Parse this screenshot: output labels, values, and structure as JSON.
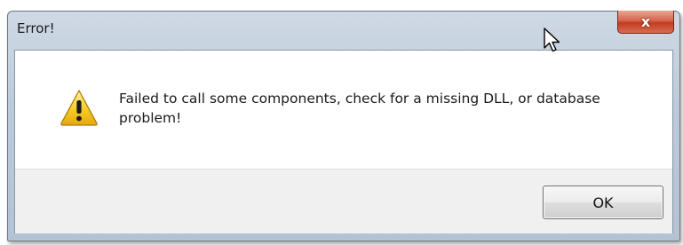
{
  "dialog": {
    "title": "Error!",
    "message": "Failed to call some components, check for a missing DLL, or database problem!",
    "ok_label": "OK",
    "close_label": "x",
    "icon": "warning-icon"
  },
  "colors": {
    "close_button": "#c23c22",
    "warning_yellow": "#f5c518",
    "title_bar": "#bccbdb"
  }
}
